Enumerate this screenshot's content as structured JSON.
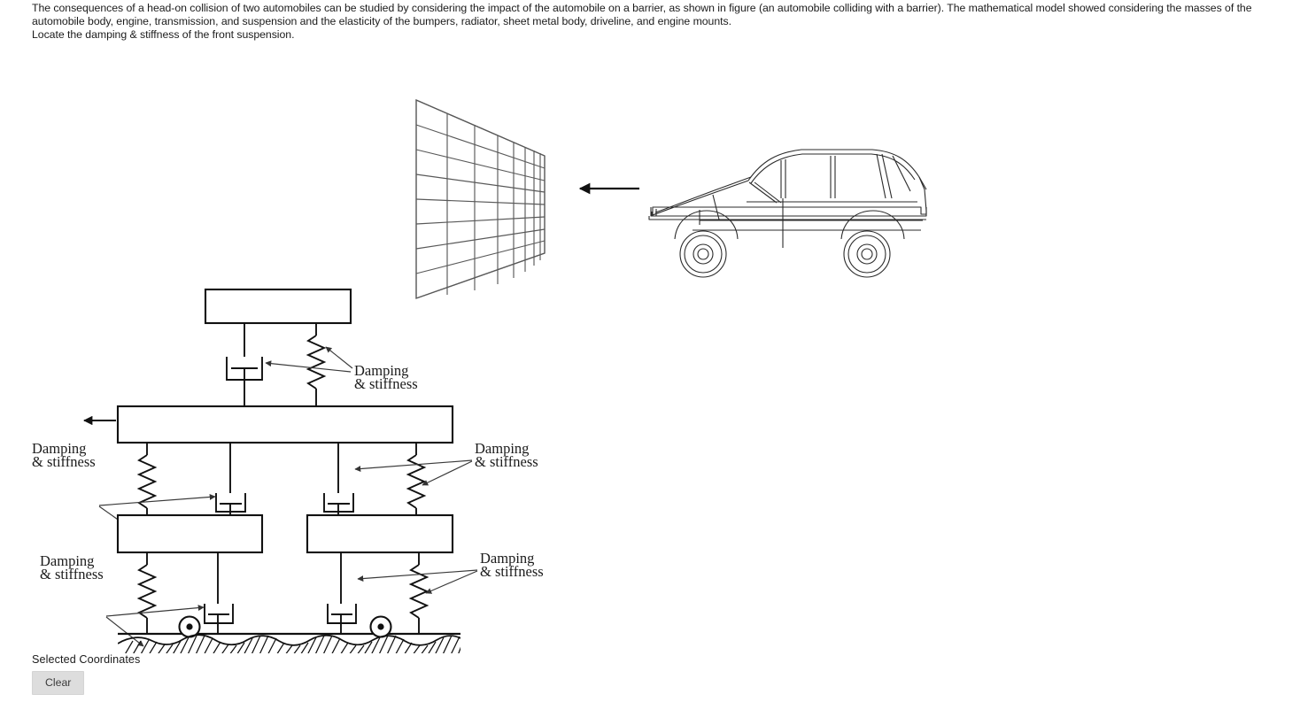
{
  "problem": {
    "paragraph_1": "The consequences of a head-on collision of two automobiles can be studied by considering the impact of the automobile on a barrier, as shown in figure (an automobile colliding with a barrier). The mathematical model showed considering the masses of the automobile body, engine, transmission, and suspension and the elasticity of the bumpers, radiator, sheet metal body, driveline, and engine mounts.",
    "paragraph_2": "Locate the damping & stiffness of the front suspension."
  },
  "figure": {
    "barrier_label": "barrier-grid-wall",
    "car_label": "automobile-side-view",
    "impact_arrow_label": "impact-direction-arrow",
    "body_arrow_label": "body-motion-arrow",
    "annotations": [
      {
        "id": "engine-suspension",
        "line1": "Damping",
        "line2": "& stiffness"
      },
      {
        "id": "front-suspension-left",
        "line1": "Damping",
        "line2": "& stiffness"
      },
      {
        "id": "rear-suspension-right",
        "line1": "Damping",
        "line2": "& stiffness"
      },
      {
        "id": "front-tire-left",
        "line1": "Damping",
        "line2": "& stiffness"
      },
      {
        "id": "rear-tire-right",
        "line1": "Damping",
        "line2": "& stiffness"
      }
    ],
    "masses": [
      {
        "id": "engine-mass"
      },
      {
        "id": "body-mass"
      },
      {
        "id": "front-suspension-mass"
      },
      {
        "id": "rear-suspension-mass"
      }
    ]
  },
  "footer": {
    "coordinates_label": "Selected Coordinates",
    "clear_label": "Clear"
  },
  "colors": {
    "background": "#ffffff",
    "text": "#1b1b1b",
    "line": "#111111",
    "grid_line": "#595959",
    "button_face": "#dddddd",
    "button_text": "#3a3a3a"
  }
}
